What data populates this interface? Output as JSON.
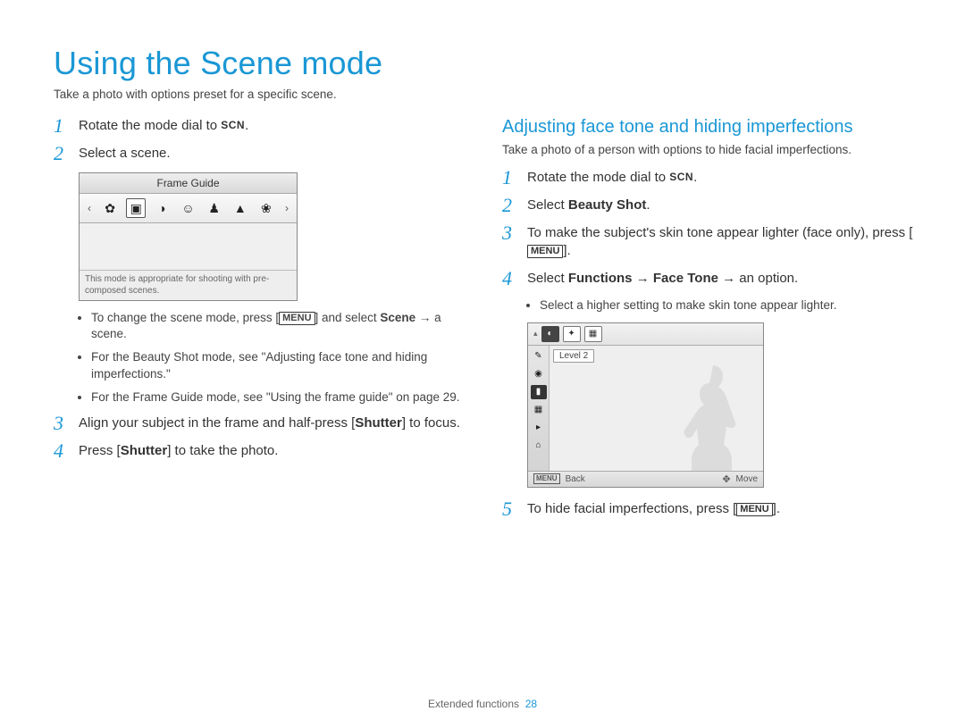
{
  "title": "Using the Scene mode",
  "subtitle": "Take a photo with options preset for a specific scene.",
  "scn_label": "SCN",
  "menu_label": "MENU",
  "left": {
    "step1": {
      "pre": "Rotate the mode dial to ",
      "post": "."
    },
    "step2": "Select a scene.",
    "lcd_title": "Frame Guide",
    "lcd_desc": "This mode is appropriate for shooting with pre-composed scenes.",
    "b1": {
      "pre": "To change the scene mode, press [",
      "mid": "] and select ",
      "bold": "Scene",
      "post": " → a scene."
    },
    "b2": "For the Beauty Shot mode, see \"Adjusting face tone and hiding imperfections.\"",
    "b3": "For the Frame Guide mode, see \"Using the frame guide\" on page 29.",
    "step3": {
      "pre": "Align your subject in the frame and half-press [",
      "bold": "Shutter",
      "post": "] to focus."
    },
    "step4": {
      "pre": "Press [",
      "bold": "Shutter",
      "post": "] to take the photo."
    }
  },
  "right": {
    "heading": "Adjusting face tone and hiding imperfections",
    "sub": "Take a photo of a person with options to hide facial imperfections.",
    "step1": {
      "pre": "Rotate the mode dial to ",
      "post": "."
    },
    "step2": {
      "pre": "Select ",
      "bold": "Beauty Shot",
      "post": "."
    },
    "step3": {
      "pre": "To make the subject's skin tone appear lighter (face only), press [",
      "post": "]."
    },
    "step4": {
      "pre": "Select ",
      "b1": "Functions",
      "arrow": " → ",
      "b2": "Face Tone",
      "post": " → an option."
    },
    "b1": "Select a higher setting to make skin tone appear lighter.",
    "level": "Level 2",
    "back": "Back",
    "move": "Move",
    "step5": {
      "pre": "To hide facial imperfections, press [",
      "post": "]."
    }
  },
  "footer": {
    "section": "Extended functions",
    "page": "28"
  }
}
